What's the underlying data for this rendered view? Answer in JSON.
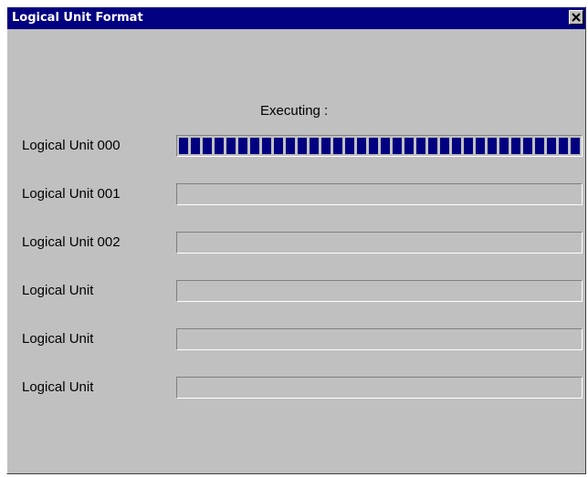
{
  "window": {
    "title": "Logical Unit Format"
  },
  "status": {
    "label": "Executing :"
  },
  "rows": [
    {
      "label": "Logical Unit 000",
      "progress": 1.0
    },
    {
      "label": "Logical Unit 001",
      "progress": 0
    },
    {
      "label": "Logical Unit 002",
      "progress": 0
    },
    {
      "label": "Logical Unit",
      "progress": 0
    },
    {
      "label": "Logical Unit",
      "progress": 0
    },
    {
      "label": "Logical Unit",
      "progress": 0
    }
  ],
  "colors": {
    "titlebar": "#000080",
    "progress_fill": "#000080",
    "dialog_bg": "#c0c0c0"
  },
  "icons": {
    "close": "close-icon"
  }
}
